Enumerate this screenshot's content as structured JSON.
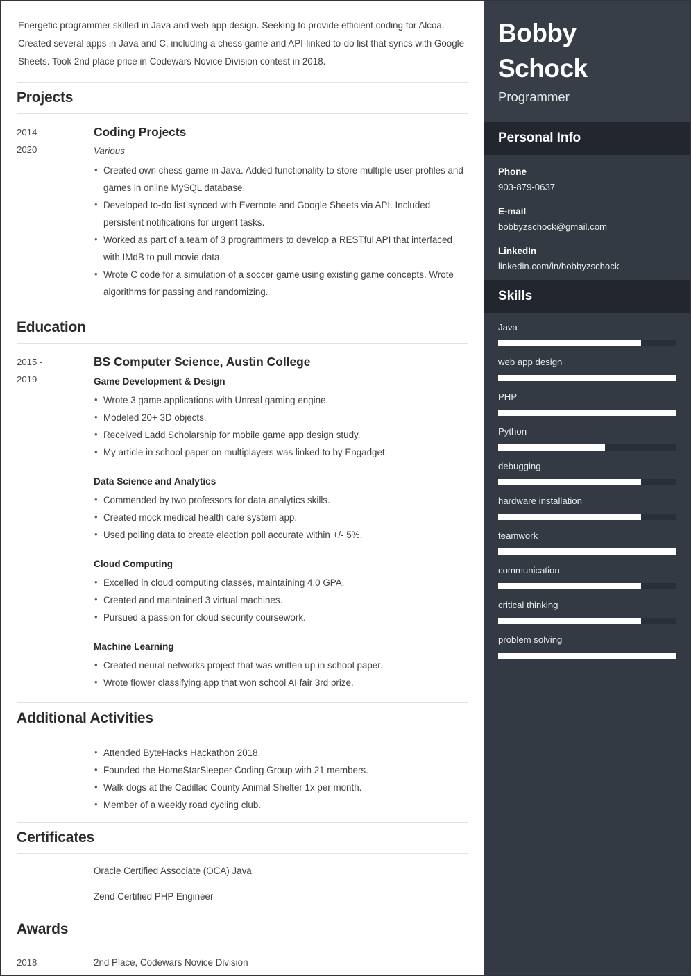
{
  "theme": {
    "sidebar_bg": "#333a43",
    "sidebar_header_bg": "#373e48",
    "sidebar_section_bg": "#22262f",
    "bar_fill": "#ffffff",
    "bar_track": "#2a2e39",
    "text_dark": "#2c2c2c",
    "rule": "#e2e2e2"
  },
  "summary": "Energetic programmer skilled in Java and web app design. Seeking to provide efficient coding for Alcoa. Created several apps in Java and C, including a chess game and API-linked to-do list that syncs with Google Sheets. Took 2nd place price in Codewars Novice Division contest in 2018.",
  "sections": {
    "projects": {
      "heading": "Projects",
      "entry": {
        "date": "2014 - 2020",
        "date_line1": "2014 -",
        "date_line2": "2020",
        "title": "Coding Projects",
        "subtitle": "Various",
        "bullets": [
          "Created own chess game in Java. Added functionality to store multiple user profiles and games in online MySQL database.",
          "Developed to-do list synced with Evernote and Google Sheets via API. Included persistent notifications for urgent tasks.",
          "Worked as part of a team of 3 programmers to develop a RESTful API that interfaced with IMdB to pull movie data.",
          "Wrote C code for a simulation of a soccer game using existing game concepts. Wrote algorithms for passing and randomizing."
        ]
      }
    },
    "education": {
      "heading": "Education",
      "entry": {
        "date_line1": "2015 -",
        "date_line2": "2019",
        "title": "BS Computer Science, Austin College",
        "subgroups": [
          {
            "title": "Game Development & Design",
            "bullets": [
              "Wrote 3 game applications with Unreal gaming engine.",
              "Modeled 20+ 3D objects.",
              "Received Ladd Scholarship for mobile game app design study.",
              "My article in school paper on multiplayers was linked to by Engadget."
            ]
          },
          {
            "title": "Data Science and Analytics",
            "bullets": [
              "Commended by two professors for data analytics skills.",
              "Created mock medical health care system app.",
              "Used polling data to create election poll accurate within +/- 5%."
            ]
          },
          {
            "title": "Cloud Computing",
            "bullets": [
              "Excelled in cloud computing classes, maintaining 4.0 GPA.",
              "Created and maintained 3 virtual machines.",
              "Pursued a passion for cloud security coursework."
            ]
          },
          {
            "title": "Machine Learning",
            "bullets": [
              "Created neural networks project that was written up in school paper.",
              "Wrote flower classifying app that won school AI fair 3rd prize."
            ]
          }
        ]
      }
    },
    "additional_activities": {
      "heading": "Additional Activities",
      "bullets": [
        "Attended ByteHacks Hackathon 2018.",
        "Founded the HomeStarSleeper Coding Group with 21 members.",
        "Walk dogs at the Cadillac County Animal Shelter 1x per month.",
        "Member of a weekly road cycling club."
      ]
    },
    "certificates": {
      "heading": "Certificates",
      "items": [
        "Oracle Certified Associate (OCA) Java",
        "Zend Certified PHP Engineer"
      ]
    },
    "awards": {
      "heading": "Awards",
      "rows": [
        {
          "date": "2018",
          "text": "2nd Place, Codewars Novice Division"
        }
      ]
    }
  },
  "sidebar": {
    "name_line1": "Bobby",
    "name_line2": "Schock",
    "role": "Programmer",
    "personal_info": {
      "heading": "Personal Info",
      "items": [
        {
          "label": "Phone",
          "value": "903-879-0637"
        },
        {
          "label": "E-mail",
          "value": "bobbyzschock@gmail.com"
        },
        {
          "label": "LinkedIn",
          "value": "linkedin.com/in/bobbyzschock"
        }
      ]
    },
    "skills": {
      "heading": "Skills",
      "items": [
        {
          "name": "Java",
          "level": 80
        },
        {
          "name": "web app design",
          "level": 100
        },
        {
          "name": "PHP",
          "level": 100
        },
        {
          "name": "Python",
          "level": 60
        },
        {
          "name": "debugging",
          "level": 80
        },
        {
          "name": "hardware installation",
          "level": 80
        },
        {
          "name": "teamwork",
          "level": 100
        },
        {
          "name": "communication",
          "level": 80
        },
        {
          "name": "critical thinking",
          "level": 80
        },
        {
          "name": "problem solving",
          "level": 100
        }
      ]
    }
  }
}
